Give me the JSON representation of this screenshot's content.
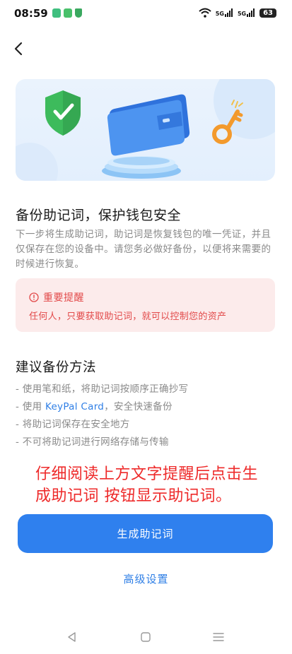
{
  "status_bar": {
    "time": "08:59",
    "signal_1": "5G",
    "signal_2": "5G",
    "battery": "63"
  },
  "hero": {
    "icons": [
      "shield-check-icon",
      "wallet-icon",
      "key-icon"
    ],
    "colors": {
      "shield": "#3dbb5c",
      "wallet": "#3a84ea",
      "key": "#f39a2d",
      "background": "#e6f1fd"
    }
  },
  "main": {
    "title": "备份助记词，保护钱包安全",
    "description": "下一步将生成助记词，助记词是恢复钱包的唯一凭证，并且仅保存在您的设备中。请您务必做好备份，以便将来需要的时候进行恢复。"
  },
  "warning": {
    "title": "重要提醒",
    "text": "任何人，只要获取助记词，就可以控制您的资产",
    "color": "#e24a4a"
  },
  "methods": {
    "title": "建议备份方法",
    "items": [
      "- 使用笔和纸，将助记词按顺序正确抄写",
      "- 使用 ",
      "- 将助记词保存在安全地方",
      "- 不可将助记词进行网络存储与传输"
    ],
    "keypal_link": "KeyPal Card",
    "keypal_suffix": "，安全快速备份"
  },
  "instruction": "仔细阅读上方文字提醒后点击生成助记词 按钮显示助记词。",
  "actions": {
    "generate_label": "生成助记词",
    "advanced_label": "高级设置",
    "accent": "#2f80ee"
  }
}
